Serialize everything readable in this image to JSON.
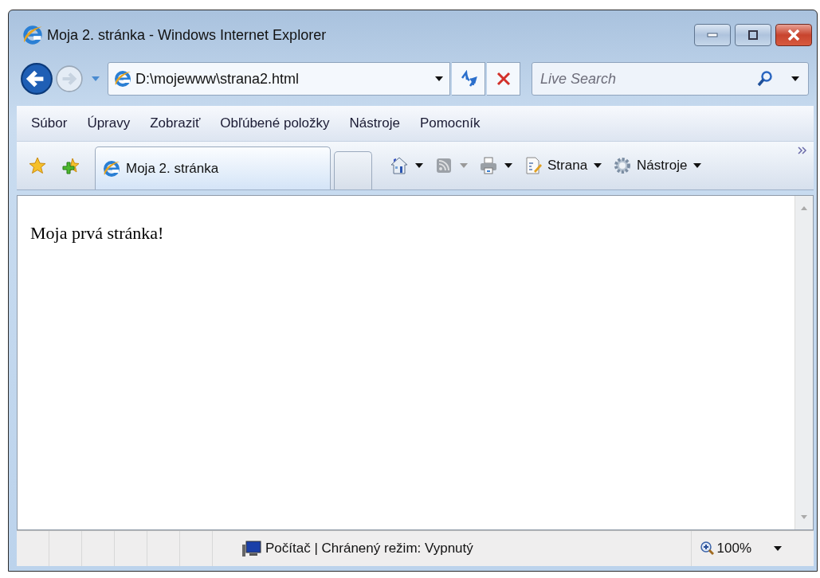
{
  "window": {
    "title": "Moja 2. stránka - Windows Internet Explorer"
  },
  "address_bar": {
    "value": "D:\\mojewww\\strana2.html"
  },
  "search": {
    "placeholder": "Live Search"
  },
  "menu": [
    "Súbor",
    "Úpravy",
    "Zobraziť",
    "Obľúbené položky",
    "Nástroje",
    "Pomocník"
  ],
  "tabs": [
    {
      "label": "Moja 2. stránka",
      "selected": true
    }
  ],
  "commands": [
    {
      "kind": "home",
      "disabled": false
    },
    {
      "kind": "feeds",
      "disabled": true
    },
    {
      "kind": "print",
      "disabled": false
    },
    {
      "kind": "page",
      "label": "Strana",
      "disabled": false
    },
    {
      "kind": "tools",
      "label": "Nástroje",
      "disabled": false
    }
  ],
  "page": {
    "text": "Moja prvá stránka!"
  },
  "status_bar": {
    "zone": "Počítač | Chránený režim: Vypnutý",
    "zoom": "100%"
  }
}
